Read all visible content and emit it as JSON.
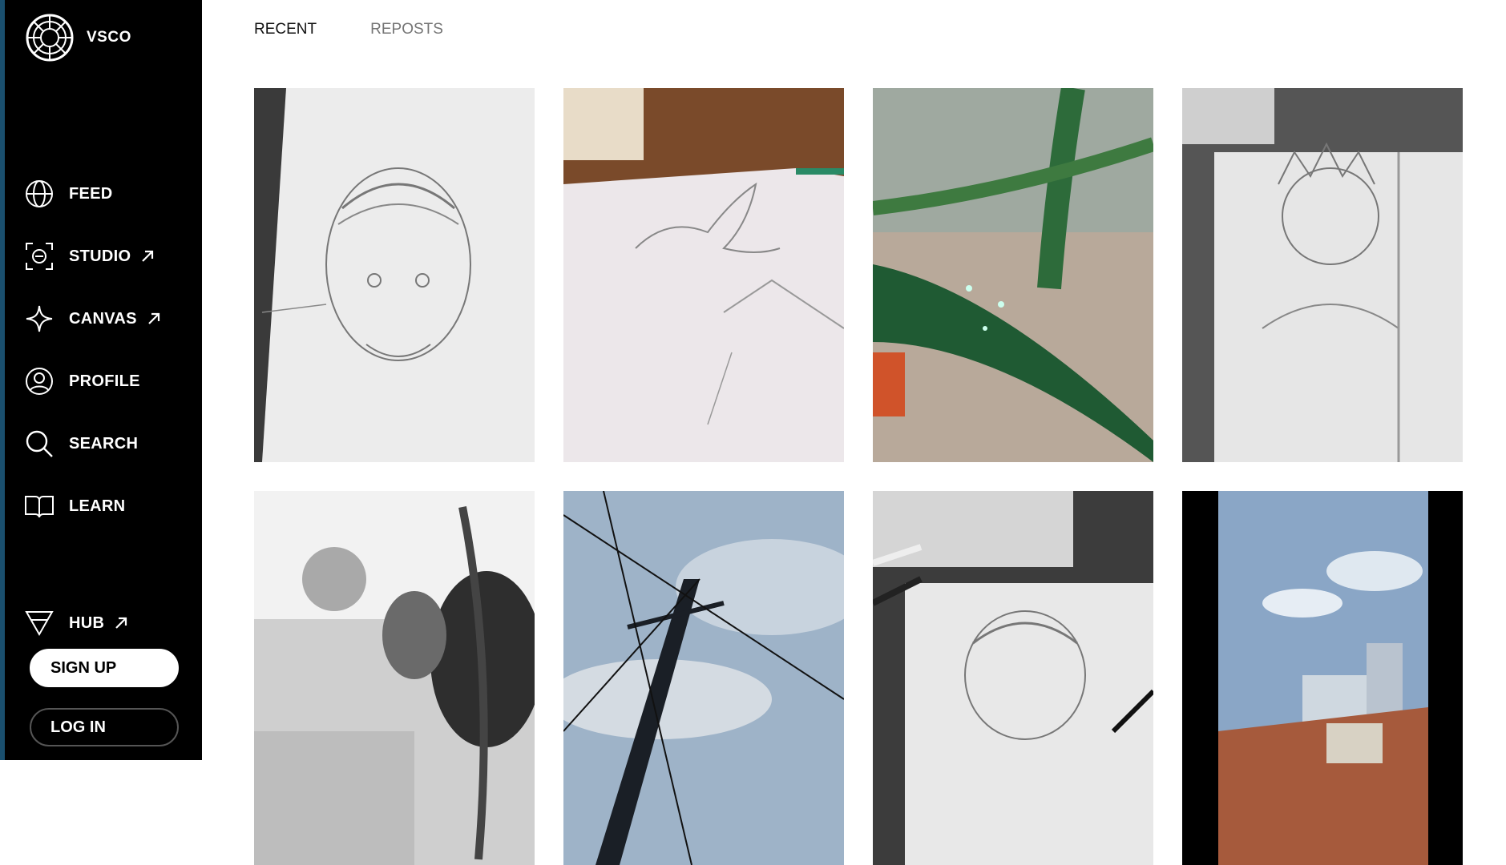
{
  "brand": {
    "name": "VSCO"
  },
  "nav": {
    "feed": "FEED",
    "studio": "STUDIO",
    "canvas": "CANVAS",
    "profile": "PROFILE",
    "search": "SEARCH",
    "learn": "LEARN",
    "hub": "HUB"
  },
  "auth": {
    "signup": "SIGN UP",
    "login": "LOG IN"
  },
  "tabs": {
    "recent": "RECENT",
    "reposts": "REPOSTS"
  },
  "colors": {
    "sidebar": "#000000",
    "edge": "#1a4f6e",
    "page": "#ffffff",
    "tab_inactive": "#757575"
  },
  "icons": {
    "feed": "globe-icon",
    "studio": "studio-frame-icon",
    "canvas": "sparkle-star-icon",
    "profile": "user-circle-icon",
    "search": "search-icon",
    "learn": "open-book-icon",
    "hub": "triangle-down-icon",
    "external": "arrow-up-right-icon"
  },
  "gallery": [
    {
      "subject": "pencil-sketch-ape",
      "tone": "grayscale"
    },
    {
      "subject": "pencil-sketch-bird",
      "tone": "color"
    },
    {
      "subject": "green-leaf-water-drops",
      "tone": "color"
    },
    {
      "subject": "pencil-sketch-portrait",
      "tone": "grayscale"
    },
    {
      "subject": "crowd-portrait",
      "tone": "grayscale"
    },
    {
      "subject": "power-lines-sky",
      "tone": "color"
    },
    {
      "subject": "pencil-sketch-ape-with-pens",
      "tone": "grayscale"
    },
    {
      "subject": "city-rooftops-sky",
      "tone": "color"
    }
  ]
}
